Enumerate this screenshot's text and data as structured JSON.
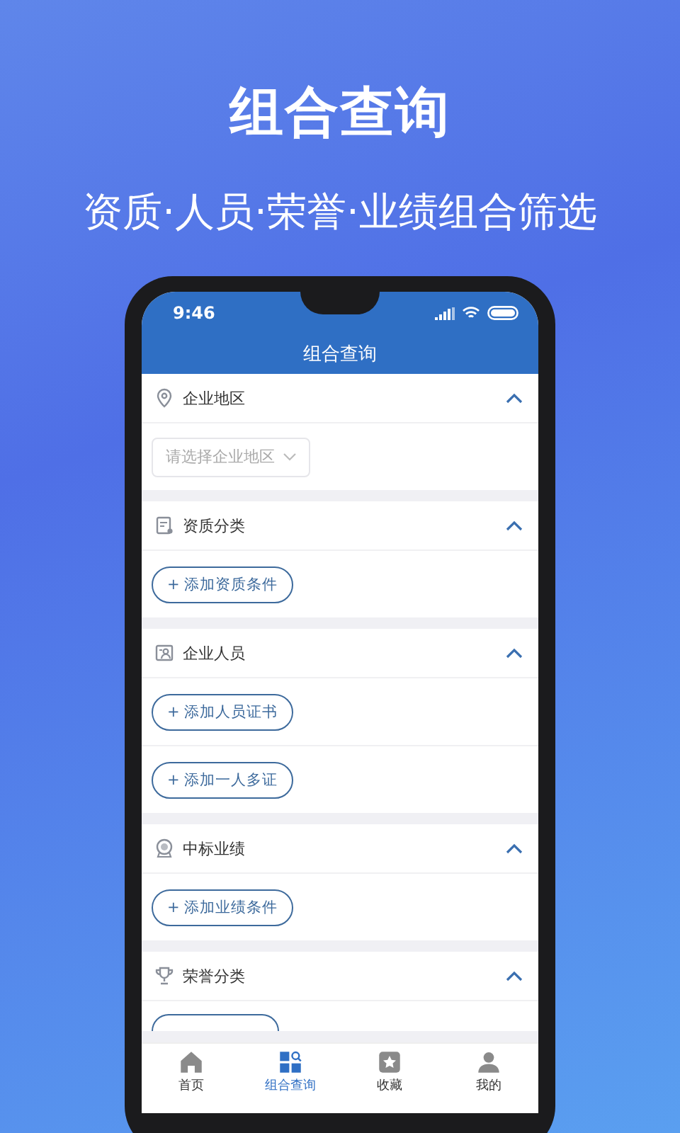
{
  "headline": "组合查询",
  "tagline": "资质·人员·荣誉·业绩组合筛选",
  "status_bar": {
    "time": "9:46"
  },
  "header": {
    "title": "组合查询"
  },
  "sections": [
    {
      "title": "企业地区",
      "expanded": true,
      "select": {
        "placeholder": "请选择企业地区"
      }
    },
    {
      "title": "资质分类",
      "expanded": true,
      "buttons": [
        "+ 添加资质条件"
      ]
    },
    {
      "title": "企业人员",
      "expanded": true,
      "buttons": [
        "+ 添加人员证书",
        "+ 添加一人多证"
      ]
    },
    {
      "title": "中标业绩",
      "expanded": true,
      "buttons": [
        "+ 添加业绩条件"
      ]
    },
    {
      "title": "荣誉分类",
      "expanded": true,
      "covered_button": true
    }
  ],
  "tabs": [
    {
      "label": "首页",
      "selected": false
    },
    {
      "label": "组合查询",
      "selected": true
    },
    {
      "label": "收藏",
      "selected": false
    },
    {
      "label": "我的",
      "selected": false
    }
  ]
}
